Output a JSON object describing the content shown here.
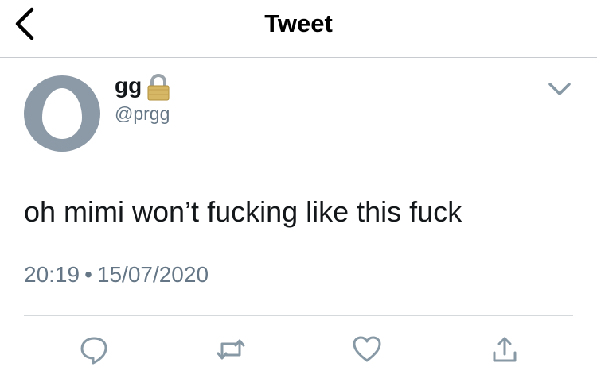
{
  "header": {
    "title": "Tweet"
  },
  "icons": {
    "back": "chevron-left-icon",
    "lock": "lock-icon",
    "more": "chevron-down-icon",
    "reply": "reply-icon",
    "retweet": "retweet-icon",
    "like": "heart-icon",
    "share": "share-icon"
  },
  "tweet": {
    "display_name": "gg",
    "handle": "@prgg",
    "text": "oh mimi won’t fucking like this fuck",
    "time": "20:19",
    "separator": "•",
    "date": "15/07/2020"
  },
  "colors": {
    "text_primary": "#14171a",
    "text_secondary": "#657786",
    "avatar_bg": "#8c99a6",
    "icon_gray": "#8899a6",
    "divider": "#d6d9dc"
  }
}
